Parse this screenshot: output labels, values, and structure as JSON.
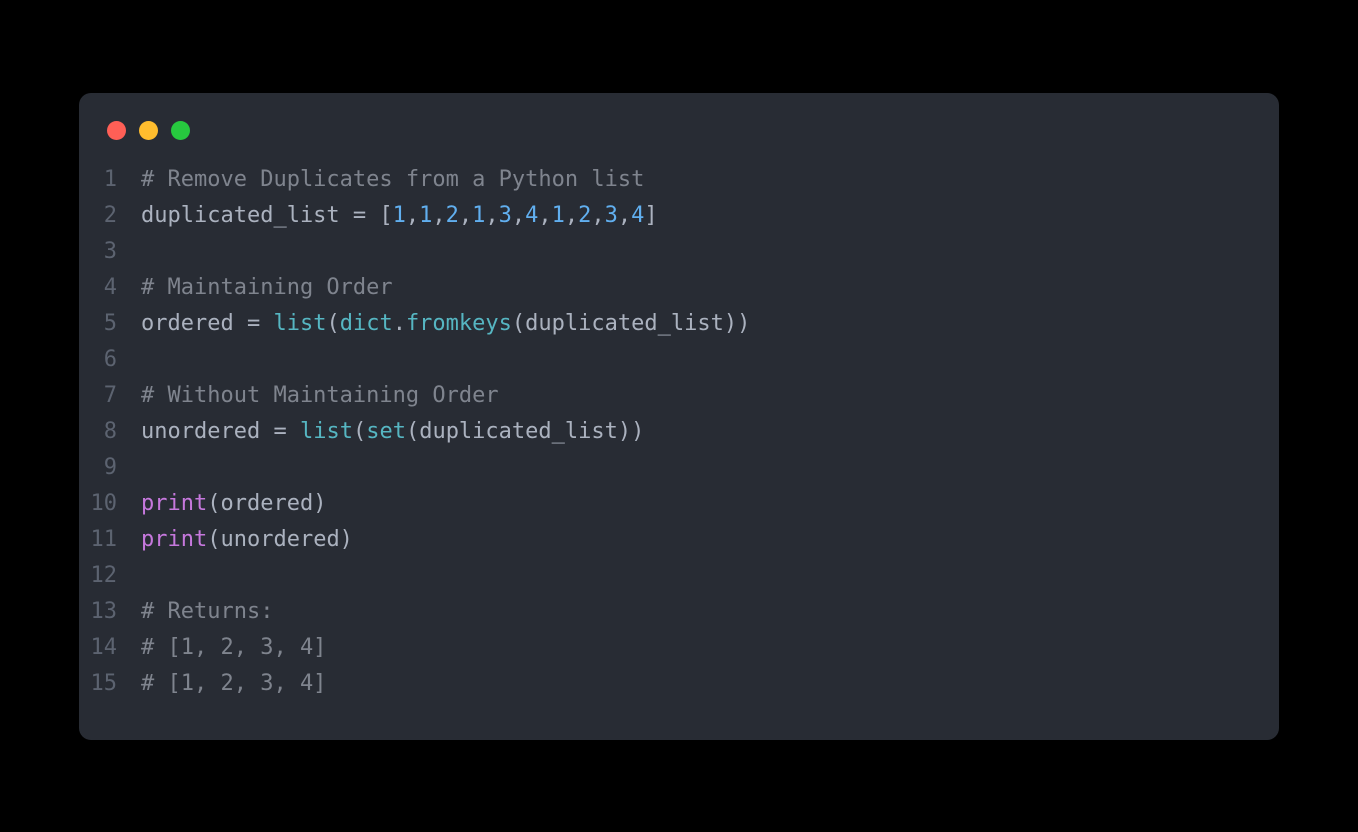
{
  "window": {
    "traffic_lights": [
      "close",
      "minimize",
      "maximize"
    ]
  },
  "code": {
    "lines": [
      {
        "num": "1",
        "tokens": [
          {
            "t": "# Remove Duplicates from a Python list",
            "c": "tok-comment"
          }
        ]
      },
      {
        "num": "2",
        "tokens": [
          {
            "t": "duplicated_list",
            "c": "tok-variable"
          },
          {
            "t": " = [",
            "c": "tok-operator"
          },
          {
            "t": "1",
            "c": "tok-number"
          },
          {
            "t": ",",
            "c": "tok-comma"
          },
          {
            "t": "1",
            "c": "tok-number"
          },
          {
            "t": ",",
            "c": "tok-comma"
          },
          {
            "t": "2",
            "c": "tok-number"
          },
          {
            "t": ",",
            "c": "tok-comma"
          },
          {
            "t": "1",
            "c": "tok-number"
          },
          {
            "t": ",",
            "c": "tok-comma"
          },
          {
            "t": "3",
            "c": "tok-number"
          },
          {
            "t": ",",
            "c": "tok-comma"
          },
          {
            "t": "4",
            "c": "tok-number"
          },
          {
            "t": ",",
            "c": "tok-comma"
          },
          {
            "t": "1",
            "c": "tok-number"
          },
          {
            "t": ",",
            "c": "tok-comma"
          },
          {
            "t": "2",
            "c": "tok-number"
          },
          {
            "t": ",",
            "c": "tok-comma"
          },
          {
            "t": "3",
            "c": "tok-number"
          },
          {
            "t": ",",
            "c": "tok-comma"
          },
          {
            "t": "4",
            "c": "tok-number"
          },
          {
            "t": "]",
            "c": "tok-operator"
          }
        ]
      },
      {
        "num": "3",
        "tokens": []
      },
      {
        "num": "4",
        "tokens": [
          {
            "t": "# Maintaining Order",
            "c": "tok-comment"
          }
        ]
      },
      {
        "num": "5",
        "tokens": [
          {
            "t": "ordered",
            "c": "tok-variable"
          },
          {
            "t": " = ",
            "c": "tok-operator"
          },
          {
            "t": "list",
            "c": "tok-builtin"
          },
          {
            "t": "(",
            "c": "tok-punct"
          },
          {
            "t": "dict",
            "c": "tok-builtin"
          },
          {
            "t": ".",
            "c": "tok-punct"
          },
          {
            "t": "fromkeys",
            "c": "tok-builtin"
          },
          {
            "t": "(duplicated_list))",
            "c": "tok-variable"
          }
        ]
      },
      {
        "num": "6",
        "tokens": []
      },
      {
        "num": "7",
        "tokens": [
          {
            "t": "# Without Maintaining Order",
            "c": "tok-comment"
          }
        ]
      },
      {
        "num": "8",
        "tokens": [
          {
            "t": "unordered",
            "c": "tok-variable"
          },
          {
            "t": " = ",
            "c": "tok-operator"
          },
          {
            "t": "list",
            "c": "tok-builtin"
          },
          {
            "t": "(",
            "c": "tok-punct"
          },
          {
            "t": "set",
            "c": "tok-builtin"
          },
          {
            "t": "(duplicated_list))",
            "c": "tok-variable"
          }
        ]
      },
      {
        "num": "9",
        "tokens": []
      },
      {
        "num": "10",
        "tokens": [
          {
            "t": "print",
            "c": "tok-function"
          },
          {
            "t": "(ordered)",
            "c": "tok-variable"
          }
        ]
      },
      {
        "num": "11",
        "tokens": [
          {
            "t": "print",
            "c": "tok-function"
          },
          {
            "t": "(unordered)",
            "c": "tok-variable"
          }
        ]
      },
      {
        "num": "12",
        "tokens": []
      },
      {
        "num": "13",
        "tokens": [
          {
            "t": "# Returns:",
            "c": "tok-comment"
          }
        ]
      },
      {
        "num": "14",
        "tokens": [
          {
            "t": "# [1, 2, 3, 4]",
            "c": "tok-comment"
          }
        ]
      },
      {
        "num": "15",
        "tokens": [
          {
            "t": "# [1, 2, 3, 4]",
            "c": "tok-comment"
          }
        ]
      }
    ]
  }
}
